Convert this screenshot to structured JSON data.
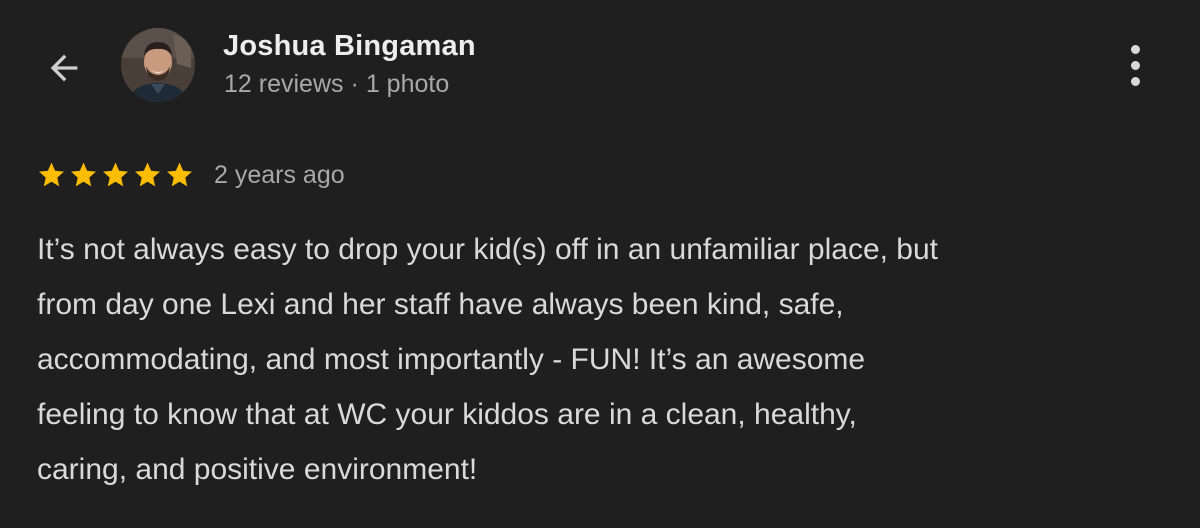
{
  "header": {
    "back_icon": "arrow-back-icon",
    "avatar_icon": "avatar-photo",
    "more_icon": "more-vertical-icon"
  },
  "reviewer": {
    "name": "Joshua Bingaman",
    "reviews": "12 reviews",
    "separator": "·",
    "photos": "1 photo"
  },
  "review": {
    "rating": 5,
    "max_rating": 5,
    "star_color": "#fbbc04",
    "time_ago": "2 years ago",
    "lines": [
      "It’s not always easy to drop your kid(s) off in an unfamiliar place, but",
      "from day one Lexi and her staff have always been kind, safe,",
      "accommodating, and most importantly - FUN! It’s an awesome",
      "feeling to know that at WC your kiddos are in a clean, healthy,",
      "caring, and positive environment!"
    ]
  },
  "colors": {
    "background": "#1f1f1f",
    "primary_text": "#ededed",
    "secondary_text": "#a8a8a8",
    "body_text": "#d9d9d9"
  }
}
